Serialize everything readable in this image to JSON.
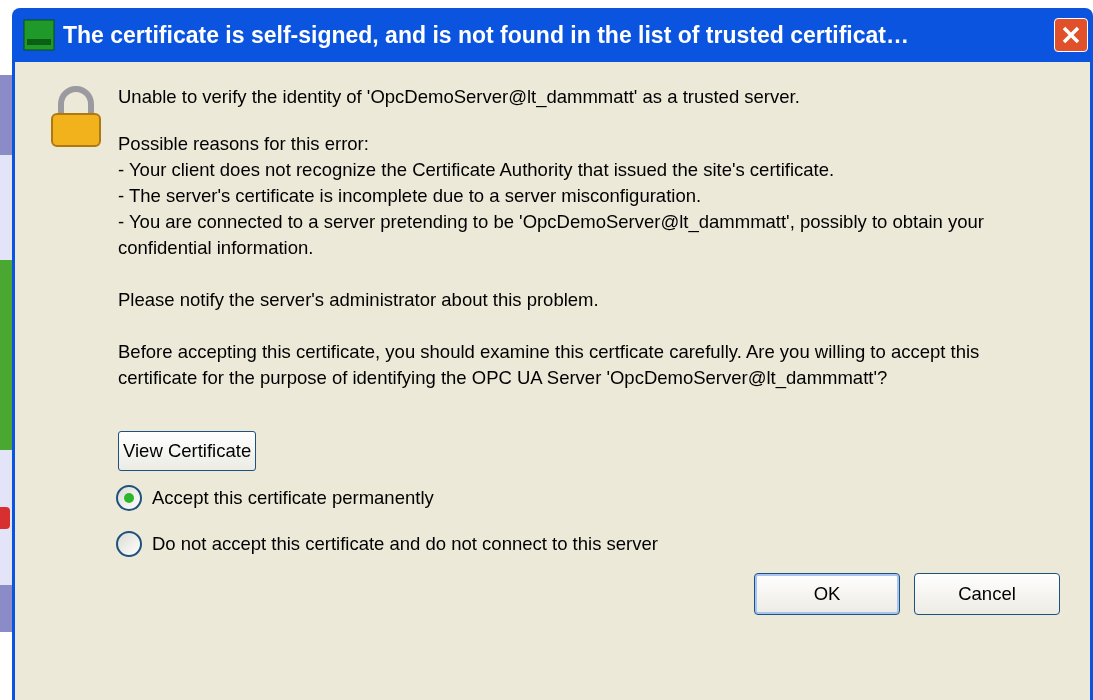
{
  "dialog": {
    "title": "The certificate is self-signed, and is not found in the list of trusted certificat…",
    "message": "Unable to verify the identity of 'OpcDemoServer@lt_dammmatt' as a trusted server.",
    "reasons_heading": "Possible reasons for this error:",
    "reasons": [
      "- Your client does not recognize the Certificate Authority that issued the site's certificate.",
      "- The server's certificate is incomplete due to a server misconfiguration.",
      "- You are connected to a server pretending to be 'OpcDemoServer@lt_dammmatt', possibly to obtain your confidential information."
    ],
    "notice": "Please notify the server's administrator about this problem.",
    "question": "Before accepting this certificate, you should examine this certficate carefully. Are you willing to accept this certificate for the purpose of identifying the OPC UA Server 'OpcDemoServer@lt_dammmatt'?",
    "view_button": "View Certificate",
    "options": [
      {
        "label": "Accept this certificate permanently",
        "selected": true
      },
      {
        "label": "Do not accept this certificate and do not connect to this server",
        "selected": false
      }
    ],
    "buttons": [
      {
        "label": "OK",
        "default": true
      },
      {
        "label": "Cancel",
        "default": false
      }
    ]
  }
}
